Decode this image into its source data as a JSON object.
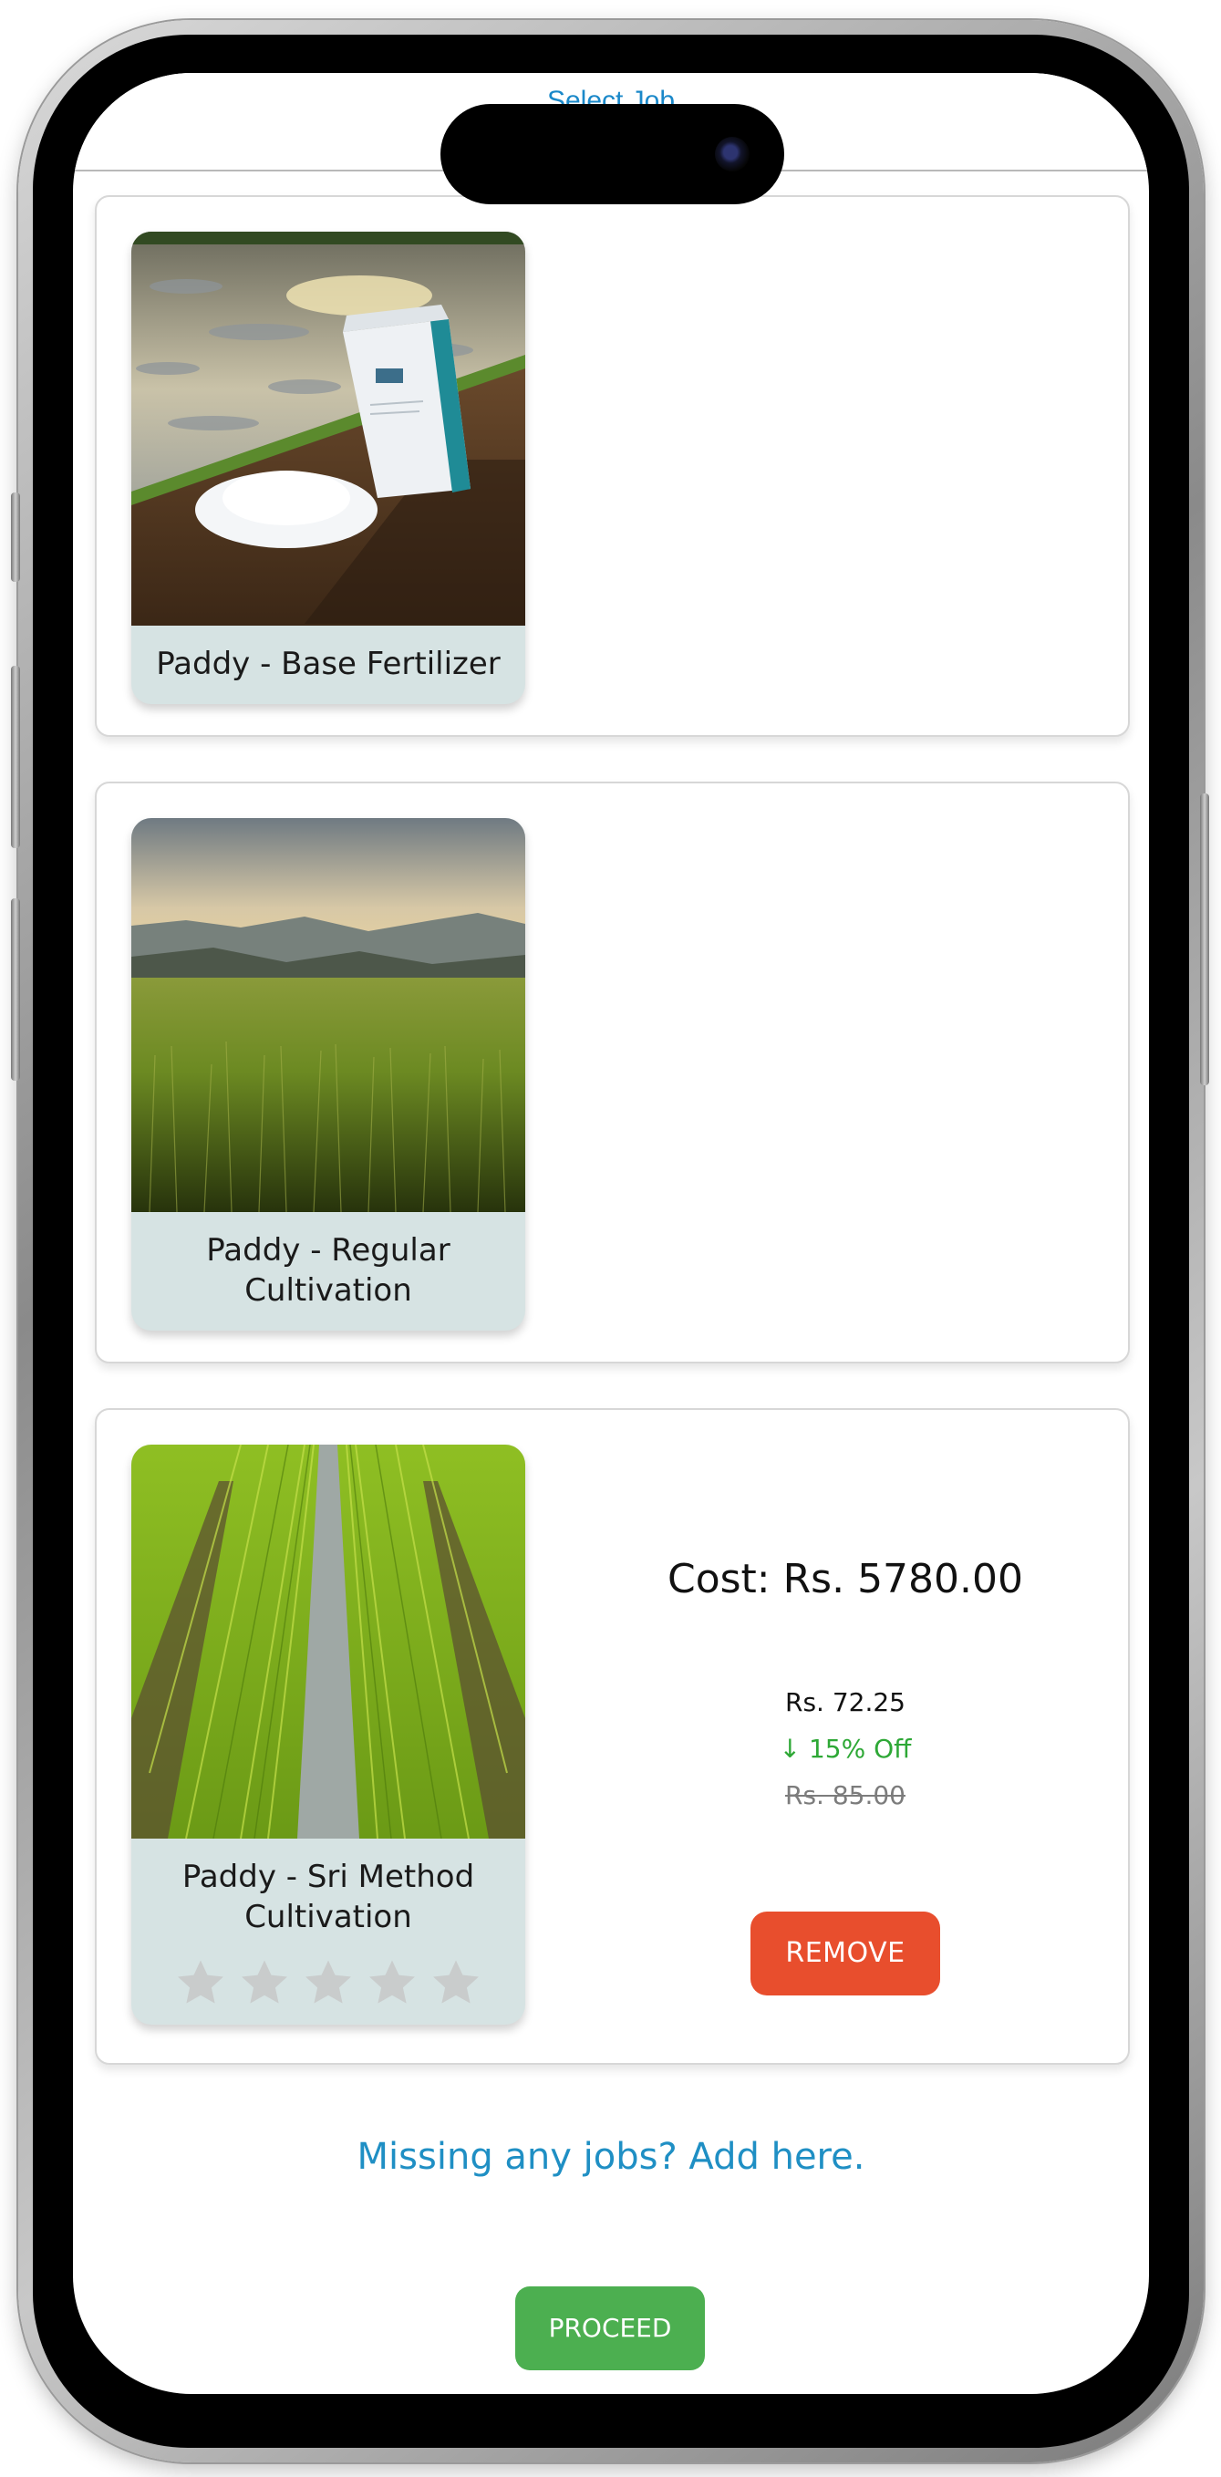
{
  "header": {
    "title": "Select Job"
  },
  "jobs": [
    {
      "title": "Paddy - Base Fertilizer",
      "image": "fertilizer-bag-on-paddy-field"
    },
    {
      "title": "Paddy - Regular Cultivation",
      "image": "paddy-field-at-sunset"
    },
    {
      "title": "Paddy - Sri Method Cultivation",
      "image": "rows-of-young-paddy",
      "rating": 0,
      "rating_max": 5,
      "cost_label": "Cost: Rs. 5780.00",
      "unit_price": "Rs. 72.25",
      "discount": "↓ 15% Off",
      "original_price": "Rs. 85.00",
      "remove_label": "REMOVE"
    }
  ],
  "footer": {
    "missing_link": "Missing any jobs? Add here.",
    "proceed_label": "PROCEED"
  },
  "colors": {
    "link": "#1f8fc4",
    "remove_button": "#e84e2d",
    "proceed_button": "#4caf50",
    "discount": "#2ea836",
    "tile_background": "#d6e3e3"
  }
}
